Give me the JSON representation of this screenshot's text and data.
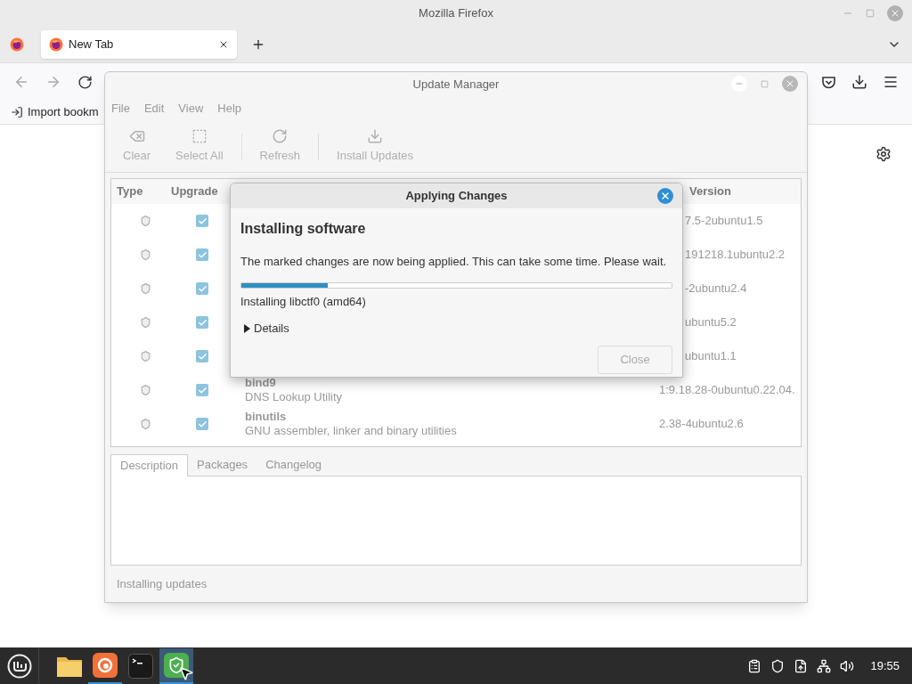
{
  "firefox": {
    "title": "Mozilla Firefox",
    "tabs": [
      {
        "label": "New Tab",
        "selected": true
      }
    ],
    "bookmarks": [
      "Import bookm"
    ]
  },
  "update_manager": {
    "title": "Update Manager",
    "menu": [
      "File",
      "Edit",
      "View",
      "Help"
    ],
    "toolbar": [
      {
        "kind": "clear",
        "label": "Clear",
        "disabled": true
      },
      {
        "kind": "select",
        "label": "Select All",
        "disabled": true
      },
      {
        "kind": "refresh",
        "label": "Refresh",
        "disabled": true
      },
      {
        "kind": "install",
        "label": "Install Updates",
        "disabled": true
      }
    ],
    "columns": [
      "Type",
      "Upgrade",
      "Version"
    ],
    "rows": [
      {
        "checked": true,
        "version": "7.5-2ubuntu1.5"
      },
      {
        "checked": true,
        "version": "191218.1ubuntu2.2"
      },
      {
        "checked": true,
        "version": "-2ubuntu2.4"
      },
      {
        "checked": true,
        "version": "ubuntu5.2"
      },
      {
        "checked": true,
        "version": "ubuntu1.1"
      },
      {
        "checked": true,
        "name": "bind9",
        "description": "DNS Lookup Utility",
        "version": "1:9.18.28-0ubuntu0.22.04."
      },
      {
        "checked": true,
        "name": "binutils",
        "description": "GNU assembler, linker and binary utilities",
        "version": "2.38-4ubuntu2.6"
      }
    ],
    "tabs": [
      {
        "label": "Description",
        "selected": true
      },
      {
        "label": "Packages",
        "selected": false
      },
      {
        "label": "Changelog",
        "selected": false
      }
    ],
    "status": "Installing updates"
  },
  "dialog": {
    "title": "Applying Changes",
    "heading": "Installing software",
    "message": "The marked changes are now being applied. This can take some time. Please wait.",
    "progress": {
      "level": 0.2
    },
    "current": "Installing libctf0 (amd64)",
    "details": {
      "label": "Details",
      "expanded": false
    },
    "close_button": {
      "label": "Close",
      "disabled": true
    }
  },
  "taskbar": {
    "apps": [
      {
        "kind": "folder",
        "running": false,
        "active": false
      },
      {
        "kind": "firefox",
        "running": true,
        "active": false
      },
      {
        "kind": "terminal",
        "running": false,
        "active": false
      },
      {
        "kind": "updates",
        "running": true,
        "active": true
      }
    ],
    "clock": "19:55"
  }
}
